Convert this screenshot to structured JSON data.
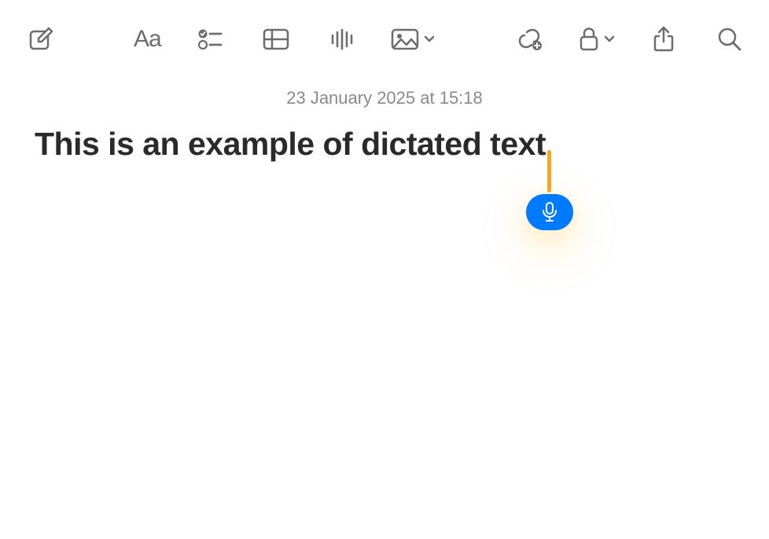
{
  "toolbar": {
    "compose_icon": "compose",
    "format_icon": "text-format",
    "checklist_icon": "checklist",
    "table_icon": "table",
    "audio_icon": "audio",
    "image_icon": "image",
    "link_icon": "link",
    "lock_icon": "lock",
    "share_icon": "share",
    "search_icon": "search"
  },
  "note": {
    "timestamp": "23 January 2025 at 15:18",
    "title": "This is an example of dictated text"
  },
  "dictation": {
    "active": true,
    "microphone_icon": "microphone"
  },
  "colors": {
    "toolbar_icon": "#6d6d6e",
    "timestamp": "#8a8a8e",
    "title": "#2a2a2a",
    "cursor": "#f5a623",
    "dictation_button": "#007aff"
  }
}
